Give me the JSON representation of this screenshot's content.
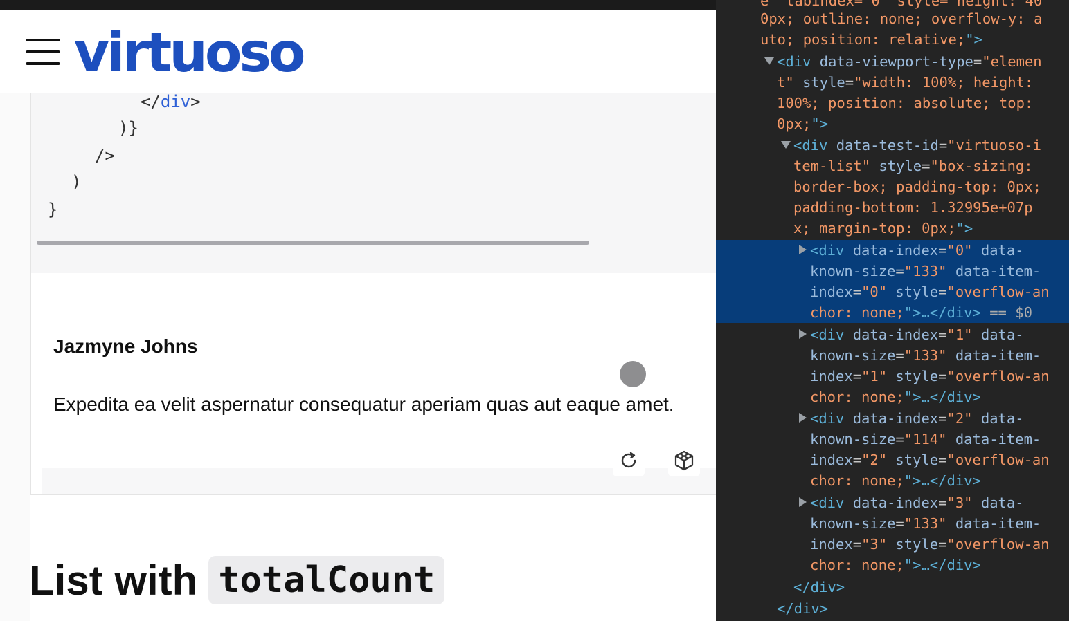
{
  "header": {
    "logo_text": "virtuoso",
    "menu_icon": "hamburger-icon"
  },
  "code_block": {
    "lines": [
      {
        "pre": "</",
        "tag": "div",
        "post": ">"
      },
      {
        "text": ")}"
      },
      {
        "text": "/>"
      },
      {
        "text": ")"
      },
      {
        "text": "}"
      }
    ]
  },
  "demo": {
    "item_name": "Jazmyne Johns",
    "item_description": "Expedita ea velit aspernatur consequatur aperiam quas aut eaque amet.",
    "refresh_icon": "refresh-icon",
    "sandbox_icon": "codesandbox-icon"
  },
  "section": {
    "heading_text": "List with",
    "heading_code": "totalCount"
  },
  "devtools": {
    "lines": [
      {
        "parts": [
          {
            "c": "av",
            "t": "e\" tabindex=\"0\" style=\"height: 40"
          }
        ]
      },
      {
        "parts": [
          {
            "c": "av",
            "t": "0px; outline: none; overflow-y: a"
          }
        ]
      },
      {
        "parts": [
          {
            "c": "av",
            "t": "uto; position: relative;"
          },
          {
            "c": "tn",
            "t": "\">"
          }
        ]
      },
      {
        "parts": [
          {
            "c": "tn",
            "t": "<div "
          },
          {
            "c": "an",
            "t": "data-viewport-type"
          },
          {
            "c": "pl",
            "t": "="
          },
          {
            "c": "av",
            "t": "\"elemen"
          }
        ]
      },
      {
        "parts": [
          {
            "c": "av",
            "t": "t\" "
          },
          {
            "c": "an",
            "t": "style"
          },
          {
            "c": "pl",
            "t": "="
          },
          {
            "c": "av",
            "t": "\"width: 100%; height:"
          }
        ]
      },
      {
        "parts": [
          {
            "c": "av",
            "t": "100%; position: absolute; top:"
          }
        ]
      },
      {
        "parts": [
          {
            "c": "av",
            "t": "0px;"
          },
          {
            "c": "tn",
            "t": "\">"
          }
        ]
      },
      {
        "parts": [
          {
            "c": "tn",
            "t": "<div "
          },
          {
            "c": "an",
            "t": "data-test-id"
          },
          {
            "c": "pl",
            "t": "="
          },
          {
            "c": "av",
            "t": "\"virtuoso-i"
          }
        ]
      },
      {
        "parts": [
          {
            "c": "av",
            "t": "tem-list\" "
          },
          {
            "c": "an",
            "t": "style"
          },
          {
            "c": "pl",
            "t": "="
          },
          {
            "c": "av",
            "t": "\"box-sizing:"
          }
        ]
      },
      {
        "parts": [
          {
            "c": "av",
            "t": "border-box; padding-top: 0px;"
          }
        ]
      },
      {
        "parts": [
          {
            "c": "av",
            "t": "padding-bottom: 1.32995e+07p"
          }
        ]
      },
      {
        "parts": [
          {
            "c": "av",
            "t": "x; margin-top: 0px;"
          },
          {
            "c": "tn",
            "t": "\">"
          }
        ]
      },
      {
        "parts": [
          {
            "c": "tn",
            "t": "<div "
          },
          {
            "c": "an",
            "t": "data-index"
          },
          {
            "c": "pl",
            "t": "="
          },
          {
            "c": "av",
            "t": "\"0\""
          },
          {
            "c": "an",
            "t": " data-"
          }
        ]
      },
      {
        "parts": [
          {
            "c": "an",
            "t": "known-size"
          },
          {
            "c": "pl",
            "t": "="
          },
          {
            "c": "av",
            "t": "\"133\""
          },
          {
            "c": "an",
            "t": " data-item-"
          }
        ]
      },
      {
        "parts": [
          {
            "c": "an",
            "t": "index"
          },
          {
            "c": "pl",
            "t": "="
          },
          {
            "c": "av",
            "t": "\"0\""
          },
          {
            "c": "an",
            "t": " style"
          },
          {
            "c": "pl",
            "t": "="
          },
          {
            "c": "av",
            "t": "\"overflow-an"
          }
        ]
      },
      {
        "parts": [
          {
            "c": "av",
            "t": "chor: none;"
          },
          {
            "c": "tn",
            "t": "\">…</div>"
          },
          {
            "c": "eq",
            "t": " == $0"
          }
        ]
      },
      {
        "parts": [
          {
            "c": "tn",
            "t": "<div "
          },
          {
            "c": "an",
            "t": "data-index"
          },
          {
            "c": "pl",
            "t": "="
          },
          {
            "c": "av",
            "t": "\"1\""
          },
          {
            "c": "an",
            "t": " data-"
          }
        ]
      },
      {
        "parts": [
          {
            "c": "an",
            "t": "known-size"
          },
          {
            "c": "pl",
            "t": "="
          },
          {
            "c": "av",
            "t": "\"133\""
          },
          {
            "c": "an",
            "t": " data-item-"
          }
        ]
      },
      {
        "parts": [
          {
            "c": "an",
            "t": "index"
          },
          {
            "c": "pl",
            "t": "="
          },
          {
            "c": "av",
            "t": "\"1\""
          },
          {
            "c": "an",
            "t": " style"
          },
          {
            "c": "pl",
            "t": "="
          },
          {
            "c": "av",
            "t": "\"overflow-an"
          }
        ]
      },
      {
        "parts": [
          {
            "c": "av",
            "t": "chor: none;"
          },
          {
            "c": "tn",
            "t": "\">…</div>"
          }
        ]
      },
      {
        "parts": [
          {
            "c": "tn",
            "t": "<div "
          },
          {
            "c": "an",
            "t": "data-index"
          },
          {
            "c": "pl",
            "t": "="
          },
          {
            "c": "av",
            "t": "\"2\""
          },
          {
            "c": "an",
            "t": " data-"
          }
        ]
      },
      {
        "parts": [
          {
            "c": "an",
            "t": "known-size"
          },
          {
            "c": "pl",
            "t": "="
          },
          {
            "c": "av",
            "t": "\"114\""
          },
          {
            "c": "an",
            "t": " data-item-"
          }
        ]
      },
      {
        "parts": [
          {
            "c": "an",
            "t": "index"
          },
          {
            "c": "pl",
            "t": "="
          },
          {
            "c": "av",
            "t": "\"2\""
          },
          {
            "c": "an",
            "t": " style"
          },
          {
            "c": "pl",
            "t": "="
          },
          {
            "c": "av",
            "t": "\"overflow-an"
          }
        ]
      },
      {
        "parts": [
          {
            "c": "av",
            "t": "chor: none;"
          },
          {
            "c": "tn",
            "t": "\">…</div>"
          }
        ]
      },
      {
        "parts": [
          {
            "c": "tn",
            "t": "<div "
          },
          {
            "c": "an",
            "t": "data-index"
          },
          {
            "c": "pl",
            "t": "="
          },
          {
            "c": "av",
            "t": "\"3\""
          },
          {
            "c": "an",
            "t": " data-"
          }
        ]
      },
      {
        "parts": [
          {
            "c": "an",
            "t": "known-size"
          },
          {
            "c": "pl",
            "t": "="
          },
          {
            "c": "av",
            "t": "\"133\""
          },
          {
            "c": "an",
            "t": " data-item-"
          }
        ]
      },
      {
        "parts": [
          {
            "c": "an",
            "t": "index"
          },
          {
            "c": "pl",
            "t": "="
          },
          {
            "c": "av",
            "t": "\"3\""
          },
          {
            "c": "an",
            "t": " style"
          },
          {
            "c": "pl",
            "t": "="
          },
          {
            "c": "av",
            "t": "\"overflow-an"
          }
        ]
      },
      {
        "parts": [
          {
            "c": "av",
            "t": "chor: none;"
          },
          {
            "c": "tn",
            "t": "\">…</div>"
          }
        ]
      },
      {
        "parts": [
          {
            "c": "tn",
            "t": "</div>"
          }
        ]
      },
      {
        "parts": [
          {
            "c": "tn",
            "t": "</div>"
          }
        ]
      }
    ]
  }
}
